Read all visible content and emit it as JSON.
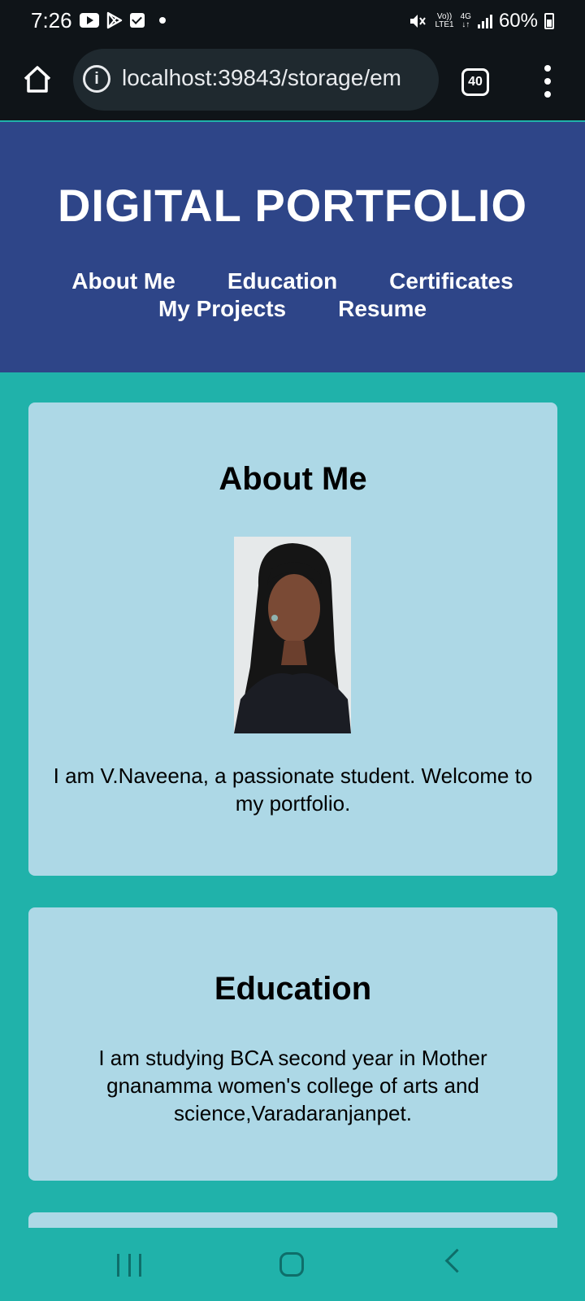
{
  "status_bar": {
    "time": "7:26",
    "network_top": "Vo))",
    "network_bottom": "LTE1",
    "network_type_top": "4G",
    "network_type_bottom": "↓↑",
    "battery": "60%",
    "icons": [
      "youtube-icon",
      "play-store-icon",
      "tasks-icon",
      "notification-dot-icon",
      "mute-icon",
      "signal-icon",
      "battery-icon"
    ]
  },
  "browser": {
    "url": "localhost:39843/storage/em",
    "tab_count": "40"
  },
  "header": {
    "title": "DIGITAL PORTFOLIO",
    "nav": [
      "About Me",
      "Education",
      "Certificates",
      "My Projects",
      "Resume"
    ]
  },
  "sections": {
    "about": {
      "heading": "About Me",
      "text": "I am V.Naveena, a passionate student. Welcome to my portfolio."
    },
    "education": {
      "heading": "Education",
      "text": "I am studying BCA second year in Mother gnanamma women's college of arts and science,Varadaranjanpet."
    }
  },
  "colors": {
    "header_bg": "#2e4588",
    "page_bg": "#20b2aa",
    "card_bg": "#add8e6",
    "browser_bg": "#0f1418"
  }
}
